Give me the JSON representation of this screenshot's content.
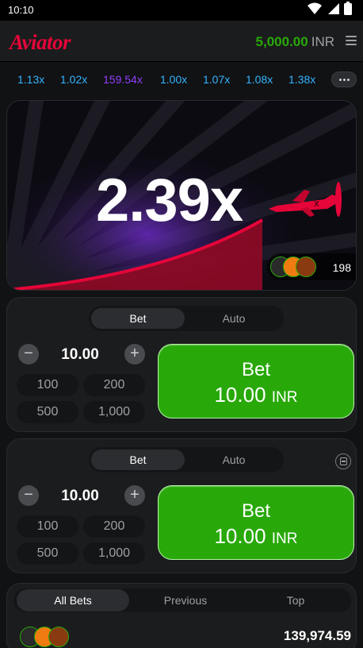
{
  "status": {
    "time": "10:10"
  },
  "header": {
    "logo": "Aviator",
    "balance_amount": "5,000.00",
    "balance_currency": "INR"
  },
  "history": [
    "1.13x",
    "1.02x",
    "159.54x",
    "1.00x",
    "1.07x",
    "1.08x",
    "1.38x"
  ],
  "game": {
    "multiplier": "2.39x",
    "players_count": "198"
  },
  "bet_panels": [
    {
      "tabs": [
        "Bet",
        "Auto"
      ],
      "active_tab": "Bet",
      "amount": "10.00",
      "quick_amounts": [
        "100",
        "200",
        "500",
        "1,000"
      ],
      "button_label": "Bet",
      "button_amount": "10.00",
      "button_currency": "INR"
    },
    {
      "tabs": [
        "Bet",
        "Auto"
      ],
      "active_tab": "Bet",
      "amount": "10.00",
      "quick_amounts": [
        "100",
        "200",
        "500",
        "1,000"
      ],
      "button_label": "Bet",
      "button_amount": "10.00",
      "button_currency": "INR"
    }
  ],
  "bets_section": {
    "tabs": [
      "All Bets",
      "Previous",
      "Top"
    ],
    "active_tab": "All Bets",
    "total_amount": "139,974.59"
  },
  "colors": {
    "brand_red": "#e50539",
    "balance_green": "#28a909",
    "bet_green": "#28a909",
    "history_blue": "#34b4ff",
    "history_purple": "#913ef8"
  },
  "icons": [
    "wifi-icon",
    "signal-icon",
    "battery-icon",
    "menu-icon",
    "more-icon",
    "minus-icon",
    "plus-icon",
    "remove-panel-icon",
    "plane-icon"
  ]
}
